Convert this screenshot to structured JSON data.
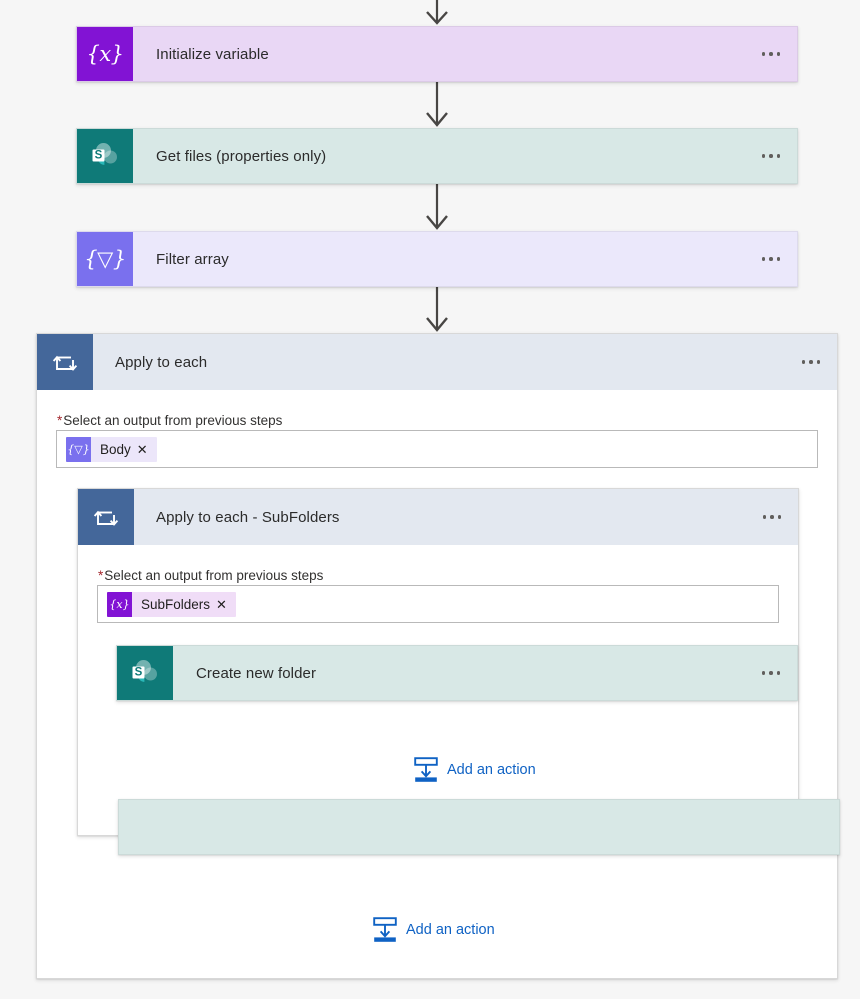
{
  "flow": {
    "steps": [
      {
        "id": "initialize-variable",
        "title": "Initialize variable",
        "icon": "variable-braces-x-icon",
        "icon_glyph": "{x}",
        "card_color": "#e9d7f5",
        "icon_color": "#8213d4",
        "menu_label": "..."
      },
      {
        "id": "get-files-properties-only",
        "title": "Get files (properties only)",
        "icon": "sharepoint-icon",
        "icon_glyph": "S",
        "card_color": "#d8e8e6",
        "icon_color": "#0f7a78",
        "menu_label": "..."
      },
      {
        "id": "filter-array",
        "title": "Filter array",
        "icon": "filter-braces-icon",
        "icon_glyph": "{▽}",
        "card_color": "#ebe8fb",
        "icon_color": "#7a70ee",
        "menu_label": "..."
      }
    ],
    "outer_loop": {
      "id": "apply-to-each",
      "title": "Apply to each",
      "icon": "loop-repeat-icon",
      "header_color": "#e3e8f0",
      "icon_color": "#44679a",
      "menu_label": "...",
      "field": {
        "label": "Select an output from previous steps",
        "required_marker": "*",
        "token": {
          "text": "Body",
          "icon": "filter-braces-icon",
          "icon_glyph": "{▽}",
          "icon_color": "#7a70ee",
          "remove_label": "✕"
        }
      },
      "add_action": {
        "label": "Add an action",
        "icon": "add-action-icon",
        "color": "#0f62c4"
      }
    },
    "inner_loop": {
      "id": "apply-to-each-subfolders",
      "title": "Apply to each - SubFolders",
      "icon": "loop-repeat-icon",
      "header_color": "#e3e8f0",
      "icon_color": "#44679a",
      "menu_label": "...",
      "field": {
        "label": "Select an output from previous steps",
        "required_marker": "*",
        "token": {
          "text": "SubFolders",
          "icon": "variable-braces-x-icon",
          "icon_glyph": "{x}",
          "icon_color": "#8213d4",
          "remove_label": "✕"
        }
      },
      "action": {
        "id": "create-new-folder",
        "title": "Create new folder",
        "icon": "sharepoint-icon",
        "icon_glyph": "S",
        "card_color": "#d8e8e6",
        "icon_color": "#0f7a78",
        "menu_label": "..."
      },
      "add_action": {
        "label": "Add an action",
        "icon": "add-action-icon",
        "color": "#0f62c4"
      }
    },
    "colors": {
      "canvas_background": "#f6f6f6",
      "connector": "#484644",
      "link_blue": "#0f62c4",
      "required_red": "#a4262c"
    }
  }
}
